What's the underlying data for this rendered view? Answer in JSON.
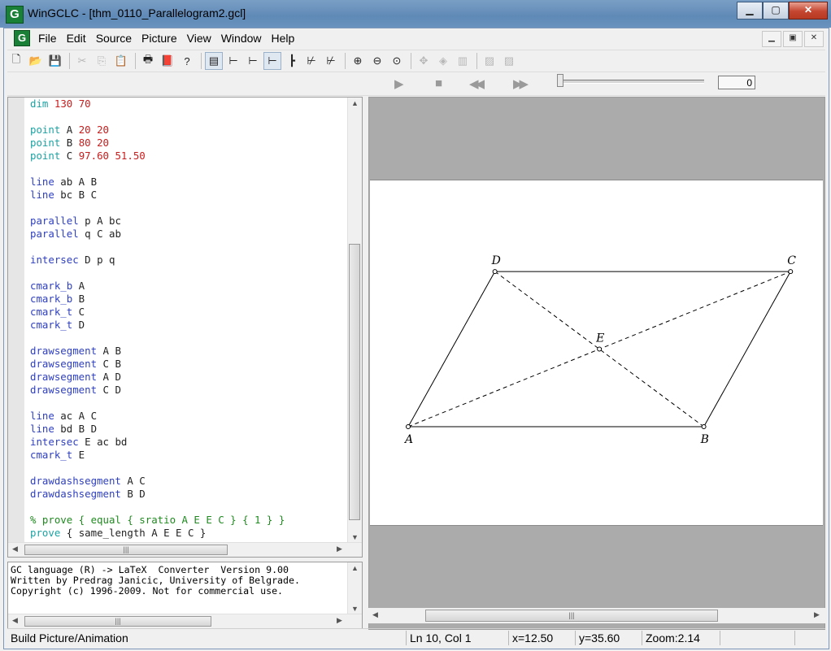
{
  "window": {
    "title": "WinGCLC - [thm_0110_Parallelogram2.gcl]",
    "app_icon_letter": "G",
    "minimize": "▁",
    "maximize": "▢",
    "close": "✕"
  },
  "menu": {
    "items": [
      "File",
      "Edit",
      "Source",
      "Picture",
      "View",
      "Window",
      "Help"
    ],
    "mdi_minimize": "▁",
    "mdi_restore": "▣",
    "mdi_close": "✕"
  },
  "toolbar": {
    "buttons": [
      {
        "name": "new-icon",
        "glyph": "🗋",
        "enabled": true
      },
      {
        "name": "open-icon",
        "glyph": "📂",
        "enabled": true
      },
      {
        "name": "save-icon",
        "glyph": "💾",
        "enabled": true
      },
      {
        "name": "sep"
      },
      {
        "name": "cut-icon",
        "glyph": "✂",
        "enabled": false
      },
      {
        "name": "copy-icon",
        "glyph": "⎘",
        "enabled": false
      },
      {
        "name": "paste-icon",
        "glyph": "📋",
        "enabled": false
      },
      {
        "name": "sep"
      },
      {
        "name": "print-icon",
        "glyph": "🖶",
        "enabled": true
      },
      {
        "name": "book-icon",
        "glyph": "📕",
        "enabled": true
      },
      {
        "name": "help-icon",
        "glyph": "?",
        "enabled": true
      },
      {
        "name": "sep"
      },
      {
        "name": "build-icon",
        "glyph": "▤",
        "enabled": true,
        "pressed": true
      },
      {
        "name": "export-latex-icon",
        "glyph": "⊢",
        "enabled": true
      },
      {
        "name": "export-pst-icon",
        "glyph": "⊢",
        "enabled": true
      },
      {
        "name": "export-tikz-icon",
        "glyph": "⊢",
        "enabled": true,
        "pressed": true
      },
      {
        "name": "export-eps-icon",
        "glyph": "┣",
        "enabled": true
      },
      {
        "name": "export-svg-icon",
        "glyph": "⊬",
        "enabled": true
      },
      {
        "name": "export-xml-icon",
        "glyph": "⊬",
        "enabled": true
      },
      {
        "name": "sep"
      },
      {
        "name": "zoom-in-icon",
        "glyph": "⊕",
        "enabled": true
      },
      {
        "name": "zoom-out-icon",
        "glyph": "⊖",
        "enabled": true
      },
      {
        "name": "zoom-fit-icon",
        "glyph": "⊙",
        "enabled": true
      },
      {
        "name": "sep"
      },
      {
        "name": "trace-icon",
        "glyph": "✥",
        "enabled": false
      },
      {
        "name": "watch-icon",
        "glyph": "◈",
        "enabled": false
      },
      {
        "name": "film-icon",
        "glyph": "▥",
        "enabled": false
      },
      {
        "name": "sep"
      },
      {
        "name": "image-icon",
        "glyph": "▨",
        "enabled": false
      },
      {
        "name": "image-export-icon",
        "glyph": "▨",
        "enabled": false
      }
    ]
  },
  "animation": {
    "play": "▶",
    "stop": "■",
    "rewind": "◀◀",
    "forward": "▶▶",
    "frame": "0",
    "position": 0
  },
  "editor": {
    "lines": [
      [
        [
          "kw2",
          "dim"
        ],
        [
          "txt",
          " "
        ],
        [
          "num",
          "130 70"
        ]
      ],
      [],
      [
        [
          "kw2",
          "point"
        ],
        [
          "txt",
          " A "
        ],
        [
          "num",
          "20 20"
        ]
      ],
      [
        [
          "kw2",
          "point"
        ],
        [
          "txt",
          " B "
        ],
        [
          "num",
          "80 20"
        ]
      ],
      [
        [
          "kw2",
          "point"
        ],
        [
          "txt",
          " C "
        ],
        [
          "num",
          "97.60 51.50"
        ]
      ],
      [],
      [
        [
          "kw",
          "line"
        ],
        [
          "txt",
          " ab A B"
        ]
      ],
      [
        [
          "kw",
          "line"
        ],
        [
          "txt",
          " bc B C"
        ]
      ],
      [],
      [
        [
          "kw",
          "parallel"
        ],
        [
          "txt",
          " p A bc"
        ]
      ],
      [
        [
          "kw",
          "parallel"
        ],
        [
          "txt",
          " q C ab"
        ]
      ],
      [],
      [
        [
          "kw",
          "intersec"
        ],
        [
          "txt",
          " D p q"
        ]
      ],
      [],
      [
        [
          "kw",
          "cmark_b"
        ],
        [
          "txt",
          " A"
        ]
      ],
      [
        [
          "kw",
          "cmark_b"
        ],
        [
          "txt",
          " B"
        ]
      ],
      [
        [
          "kw",
          "cmark_t"
        ],
        [
          "txt",
          " C"
        ]
      ],
      [
        [
          "kw",
          "cmark_t"
        ],
        [
          "txt",
          " D"
        ]
      ],
      [],
      [
        [
          "kw",
          "drawsegment"
        ],
        [
          "txt",
          " A B"
        ]
      ],
      [
        [
          "kw",
          "drawsegment"
        ],
        [
          "txt",
          " C B"
        ]
      ],
      [
        [
          "kw",
          "drawsegment"
        ],
        [
          "txt",
          " A D"
        ]
      ],
      [
        [
          "kw",
          "drawsegment"
        ],
        [
          "txt",
          " C D"
        ]
      ],
      [],
      [
        [
          "kw",
          "line"
        ],
        [
          "txt",
          " ac A C"
        ]
      ],
      [
        [
          "kw",
          "line"
        ],
        [
          "txt",
          " bd B D"
        ]
      ],
      [
        [
          "kw",
          "intersec"
        ],
        [
          "txt",
          " E ac bd"
        ]
      ],
      [
        [
          "kw",
          "cmark_t"
        ],
        [
          "txt",
          " E"
        ]
      ],
      [],
      [
        [
          "kw",
          "drawdashsegment"
        ],
        [
          "txt",
          " A C"
        ]
      ],
      [
        [
          "kw",
          "drawdashsegment"
        ],
        [
          "txt",
          " B D"
        ]
      ],
      [],
      [
        [
          "cmt",
          "% prove { equal { sratio A E E C } { 1 } }"
        ]
      ],
      [
        [
          "kw2",
          "prove"
        ],
        [
          "txt",
          " { same_length A E E C }"
        ]
      ]
    ]
  },
  "console": {
    "lines": [
      "GC language (R) -> LaTeX  Converter  Version 9.00",
      "Written by Predrag Janicic, University of Belgrade.",
      "Copyright (c) 1996-2009. Not for commercial use."
    ]
  },
  "figure": {
    "points": [
      {
        "label": "A",
        "x": 20,
        "y": 20,
        "mark": "b"
      },
      {
        "label": "B",
        "x": 80,
        "y": 20,
        "mark": "b"
      },
      {
        "label": "C",
        "x": 97.6,
        "y": 51.5,
        "mark": "t"
      },
      {
        "label": "D",
        "x": 37.6,
        "y": 51.5,
        "mark": "t"
      },
      {
        "label": "E",
        "x": 58.8,
        "y": 35.75,
        "mark": "t"
      }
    ],
    "segments": [
      [
        "A",
        "B"
      ],
      [
        "C",
        "B"
      ],
      [
        "A",
        "D"
      ],
      [
        "C",
        "D"
      ]
    ],
    "dashed_segments": [
      [
        "A",
        "C"
      ],
      [
        "B",
        "D"
      ]
    ]
  },
  "status": {
    "message": "Build Picture/Animation",
    "line_col": "Ln 10, Col 1",
    "x": "x=12.50",
    "y": "y=35.60",
    "zoom": "Zoom:2.14"
  }
}
